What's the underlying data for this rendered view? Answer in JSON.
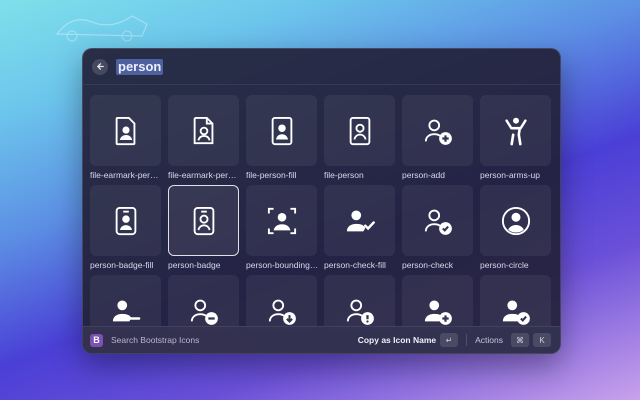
{
  "search": {
    "query": "person"
  },
  "icons": [
    {
      "label": "file-earmark-per…",
      "icon": "file-earmark-person-fill-icon"
    },
    {
      "label": "file-earmark-per…",
      "icon": "file-earmark-person-icon"
    },
    {
      "label": "file-person-fill",
      "icon": "file-person-fill-icon"
    },
    {
      "label": "file-person",
      "icon": "file-person-icon"
    },
    {
      "label": "person-add",
      "icon": "person-add-icon"
    },
    {
      "label": "person-arms-up",
      "icon": "person-arms-up-icon"
    },
    {
      "label": "person-badge-fill",
      "icon": "person-badge-fill-icon"
    },
    {
      "label": "person-badge",
      "icon": "person-badge-icon",
      "selected": true
    },
    {
      "label": "person-bounding…",
      "icon": "person-bounding-box-icon"
    },
    {
      "label": "person-check-fill",
      "icon": "person-check-fill-icon"
    },
    {
      "label": "person-check",
      "icon": "person-check-icon"
    },
    {
      "label": "person-circle",
      "icon": "person-circle-icon"
    },
    {
      "label": "",
      "icon": "person-dash-fill-icon"
    },
    {
      "label": "",
      "icon": "person-dash-icon"
    },
    {
      "label": "",
      "icon": "person-down-icon"
    },
    {
      "label": "",
      "icon": "person-exclamation-icon"
    },
    {
      "label": "",
      "icon": "person-fill-add-icon"
    },
    {
      "label": "",
      "icon": "person-fill-check-icon"
    }
  ],
  "footer": {
    "extension_name": "Search Bootstrap Icons",
    "extension_logo": "B",
    "primary_action": "Copy as Icon Name",
    "primary_key": "↵",
    "actions_label": "Actions",
    "actions_key_1": "⌘",
    "actions_key_2": "K"
  },
  "colors": {
    "accent": "#7952b3",
    "selection": "#6e8ce6"
  }
}
